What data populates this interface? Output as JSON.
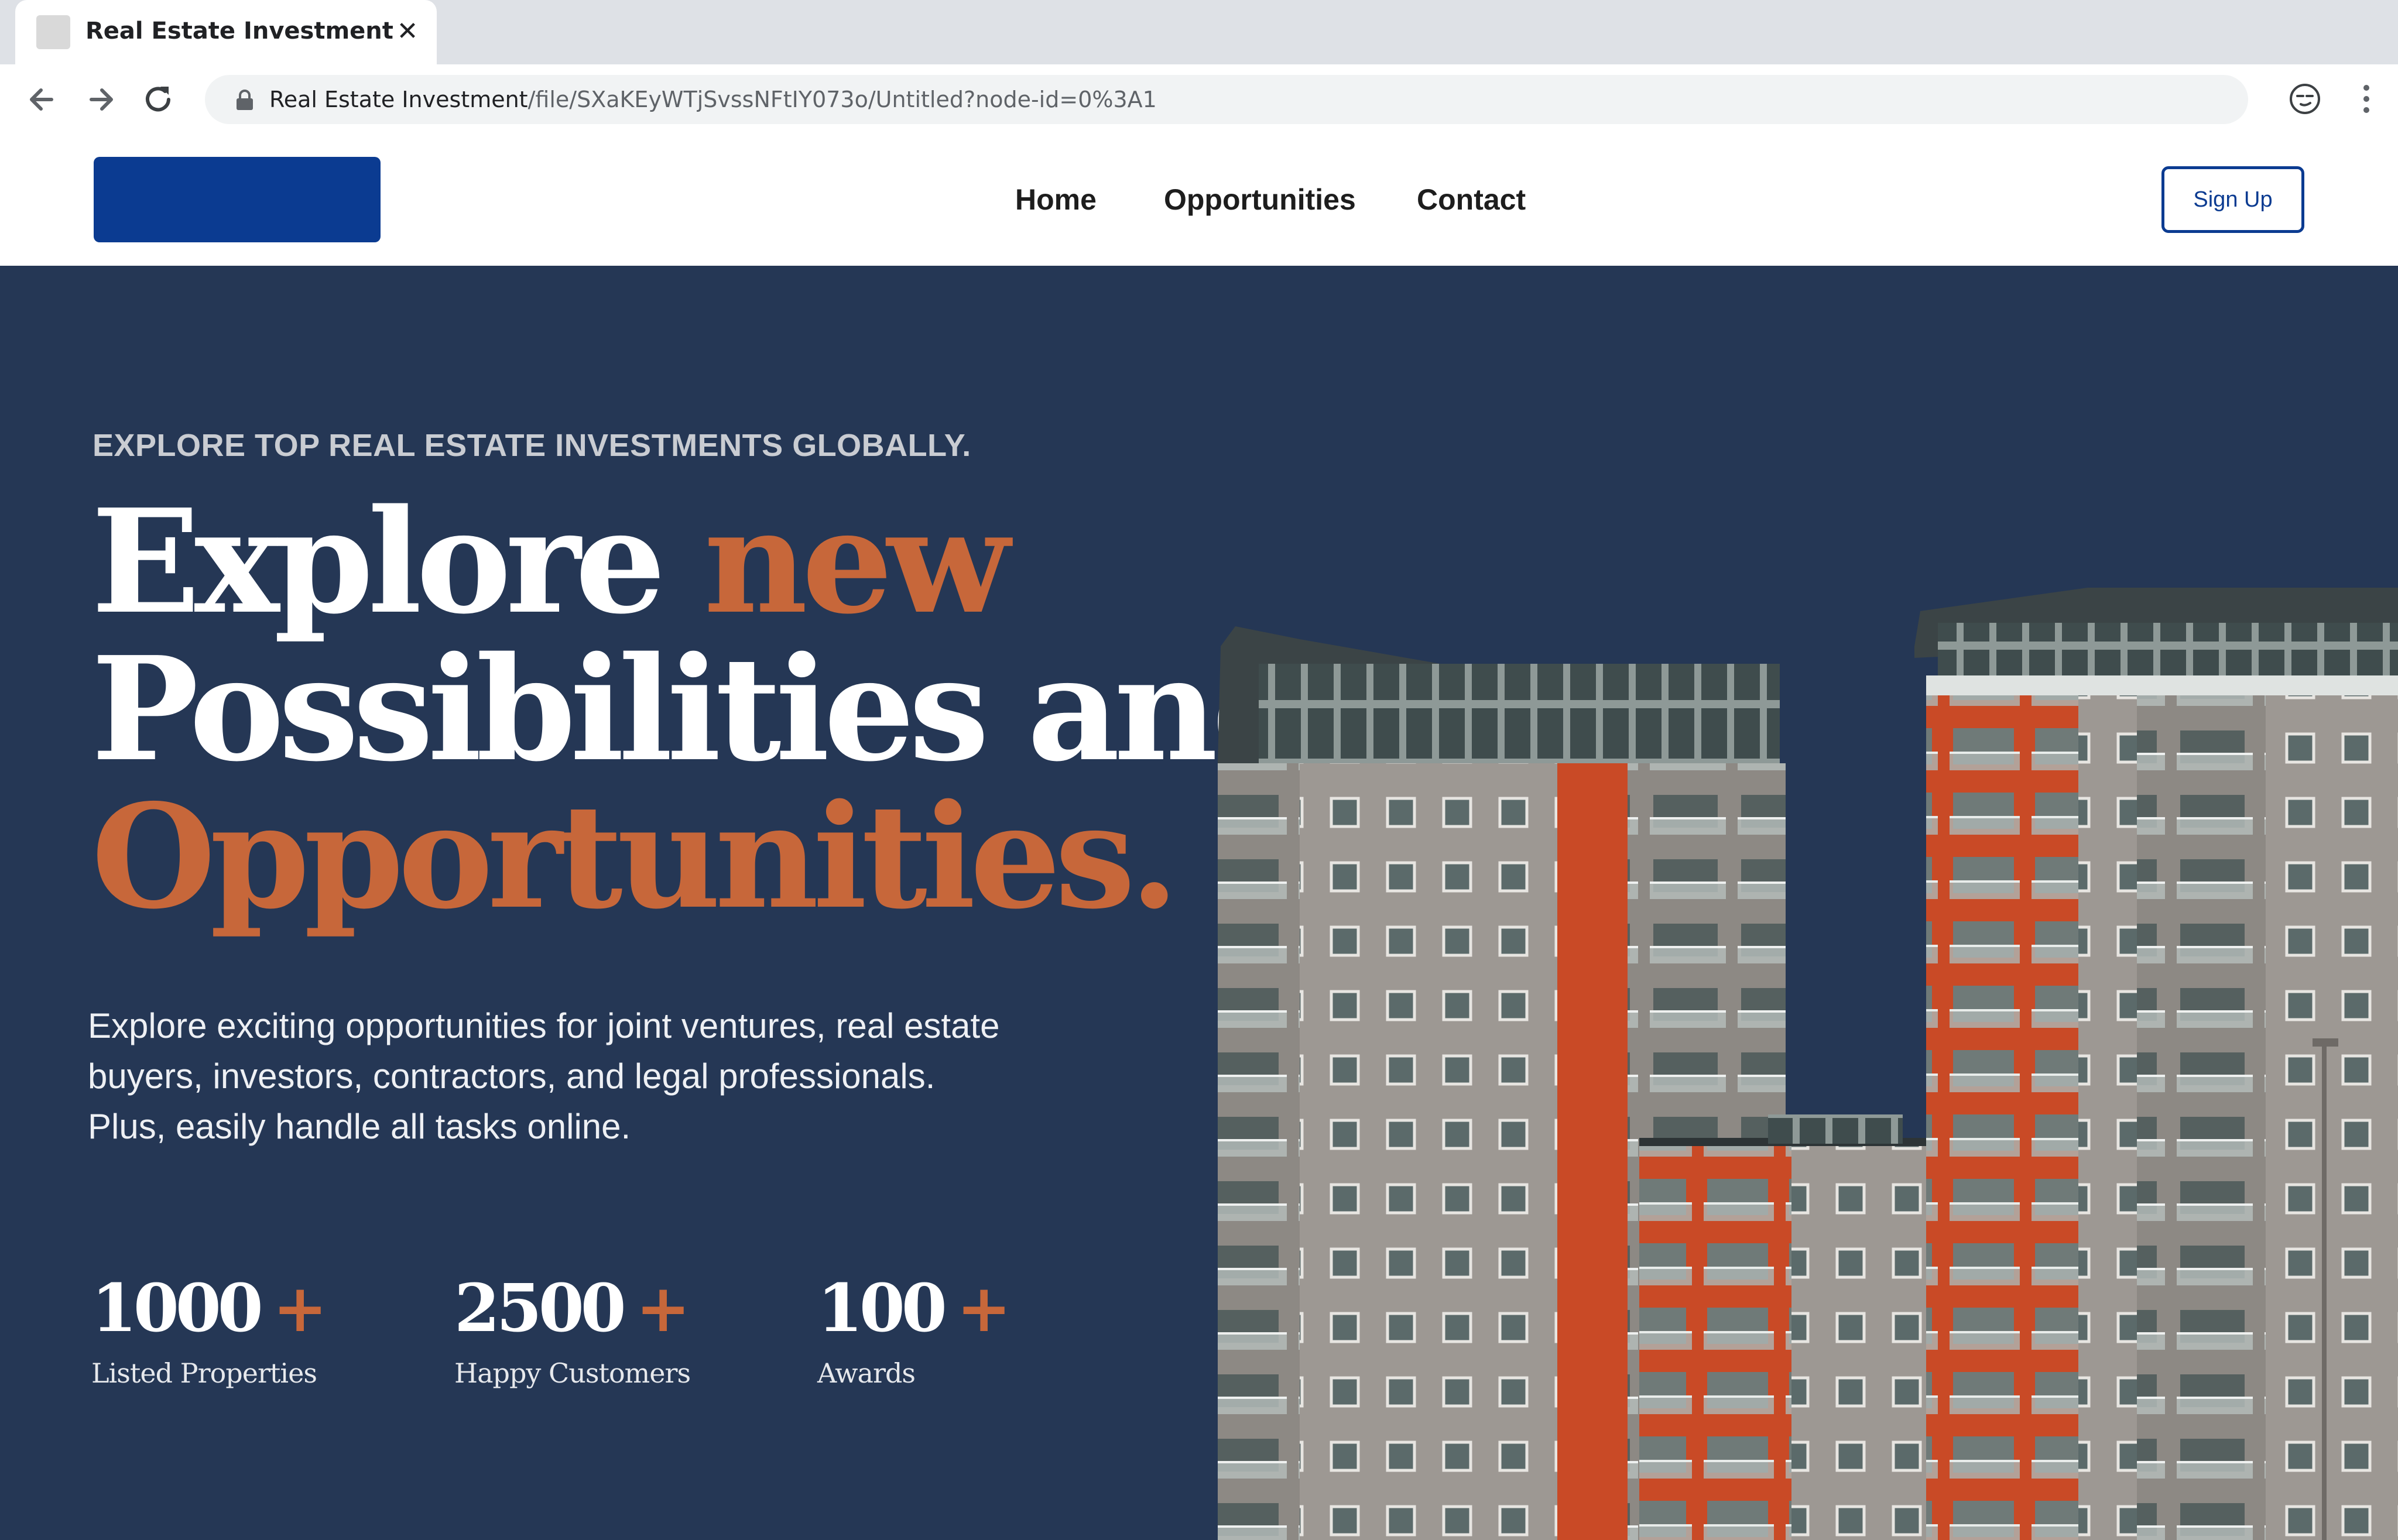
{
  "browser": {
    "tab_title": "Real Estate Investment",
    "url_host": "Real Estate Investment",
    "url_path": "/file/SXaKEyWTjSvssNFtIY073o/Untitled?node-id=0%3A1"
  },
  "header": {
    "nav": [
      "Home",
      "Opportunities",
      "Contact"
    ],
    "signup_label": "Sign Up"
  },
  "hero": {
    "eyebrow": "EXPLORE TOP REAL ESTATE INVESTMENTS GLOBALLY.",
    "headline": {
      "line1_a": "Explore ",
      "line1_b": "new",
      "line2": "Possibilities and",
      "line3": "Opportunities."
    },
    "description": "Explore exciting opportunities for joint ventures, real estate buyers, investors, contractors, and legal professionals. Plus, easily handle all tasks online.",
    "stats": [
      {
        "number": "1000",
        "plus": "+",
        "label": "Listed Properties"
      },
      {
        "number": "2500",
        "plus": "+",
        "label": "Happy Customers"
      },
      {
        "number": "100",
        "plus": "+",
        "label": "Awards"
      }
    ]
  },
  "colors": {
    "brand_blue": "#0b3b91",
    "hero_bg": "#253755",
    "accent_orange": "#c7673a"
  }
}
